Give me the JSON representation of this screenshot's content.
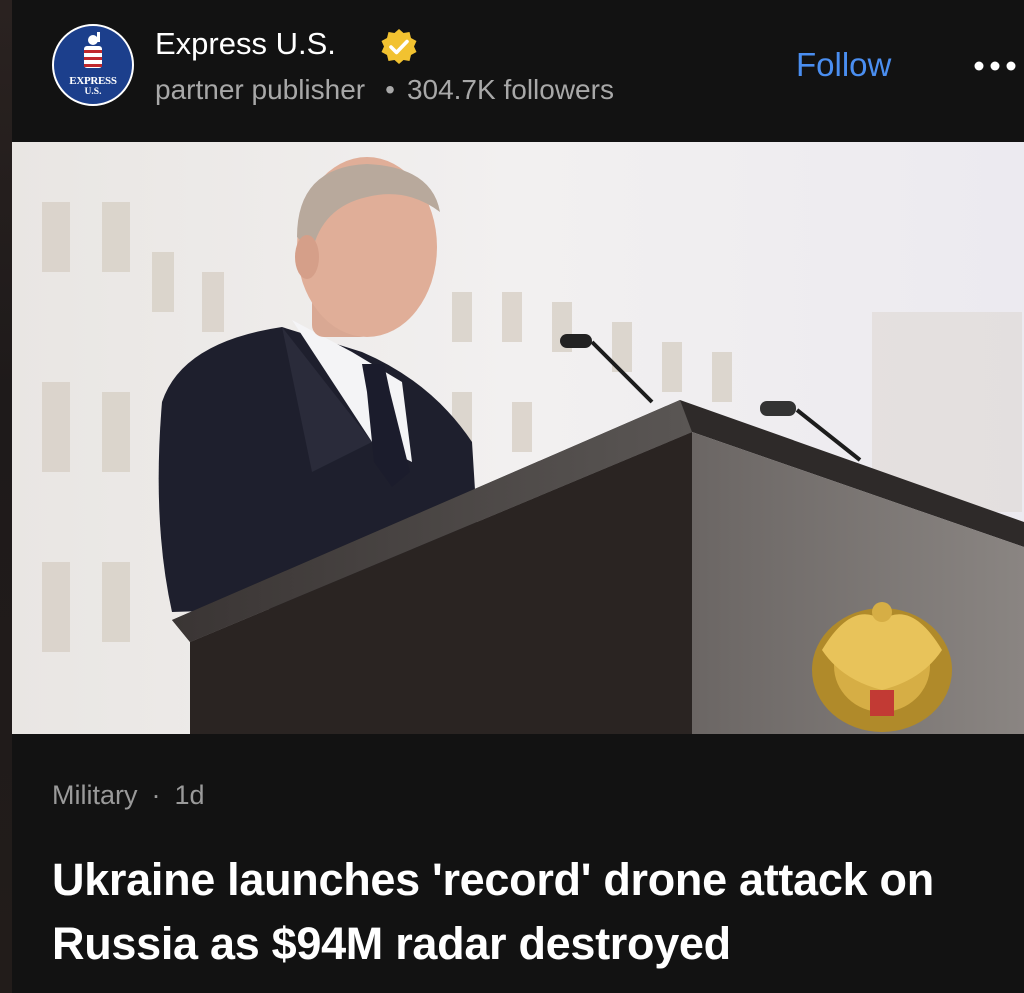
{
  "publisher": {
    "name": "Express U.S.",
    "avatar_text_line1": "EXPRESS",
    "avatar_text_line2": "U.S.",
    "badge": "verified-badge-icon",
    "type": "partner publisher",
    "followers": "304.7K followers",
    "separator": "•"
  },
  "actions": {
    "follow_label": "Follow",
    "more_icon": "more-dots-icon"
  },
  "article": {
    "category": "Military",
    "separator": "·",
    "age": "1d",
    "headline": "Ukraine launches 'record' drone attack on Russia as $94M radar destroyed"
  },
  "colors": {
    "background": "#121212",
    "accent": "#4a8ef0",
    "verified": "#f2c230"
  }
}
